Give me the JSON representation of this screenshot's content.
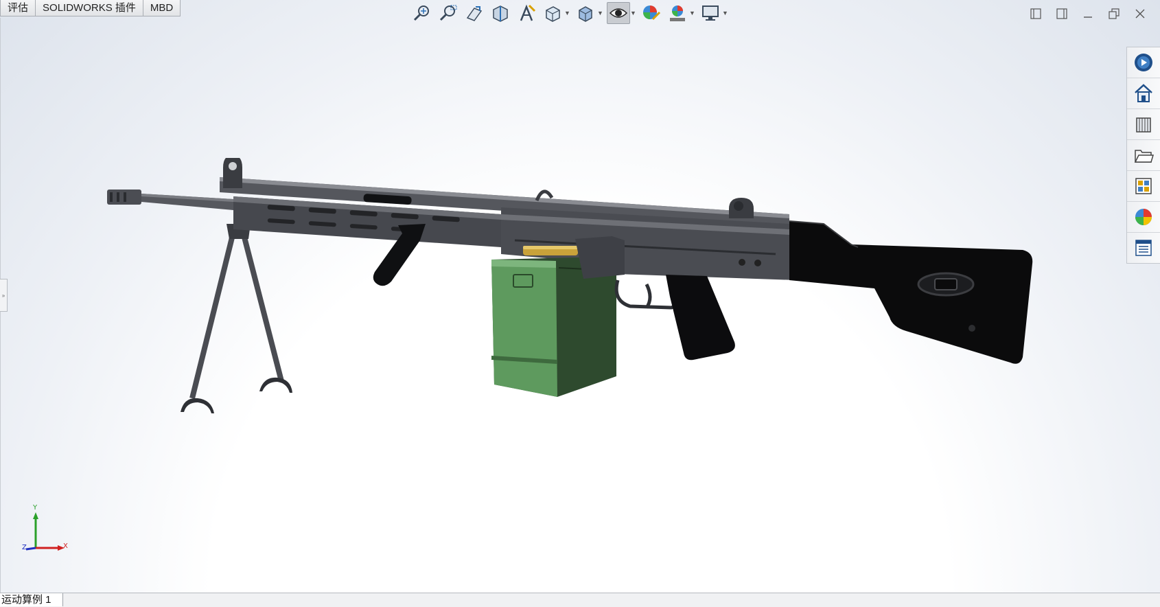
{
  "command_tabs": [
    "评估",
    "SOLIDWORKS 插件",
    "MBD"
  ],
  "hud_tools": [
    {
      "icon": "zoom-to-fit-icon"
    },
    {
      "icon": "zoom-to-area-icon"
    },
    {
      "icon": "previous-view-icon"
    },
    {
      "icon": "section-view-icon"
    },
    {
      "icon": "dynamic-annotation-views-icon"
    },
    {
      "icon": "view-orientation-icon",
      "dropdown": true
    },
    {
      "icon": "display-style-icon",
      "dropdown": true
    },
    {
      "icon": "hide-show-items-icon",
      "dropdown": true,
      "active": true
    },
    {
      "icon": "edit-appearance-icon"
    },
    {
      "icon": "apply-scene-icon",
      "dropdown": true
    },
    {
      "icon": "view-settings-icon",
      "dropdown": true
    }
  ],
  "window_controls": [
    "tile-left-icon",
    "tile-right-icon",
    "minimize-icon",
    "restore-icon",
    "close-icon"
  ],
  "task_pane": [
    "solidworks-resources-icon",
    "design-library-icon",
    "file-explorer-icon",
    "open-folder-icon",
    "view-palette-icon",
    "appearances-scenes-icon",
    "custom-properties-icon"
  ],
  "triad": {
    "x_label": "X",
    "y_label": "Y",
    "z_label": "Z"
  },
  "colors": {
    "ammo_box": "#4f8a4f",
    "metal": "#3b3d42",
    "stock": "#0b0b0c",
    "brass": "#c9a23a"
  },
  "status": {
    "study_tab": "运动算例 1"
  }
}
